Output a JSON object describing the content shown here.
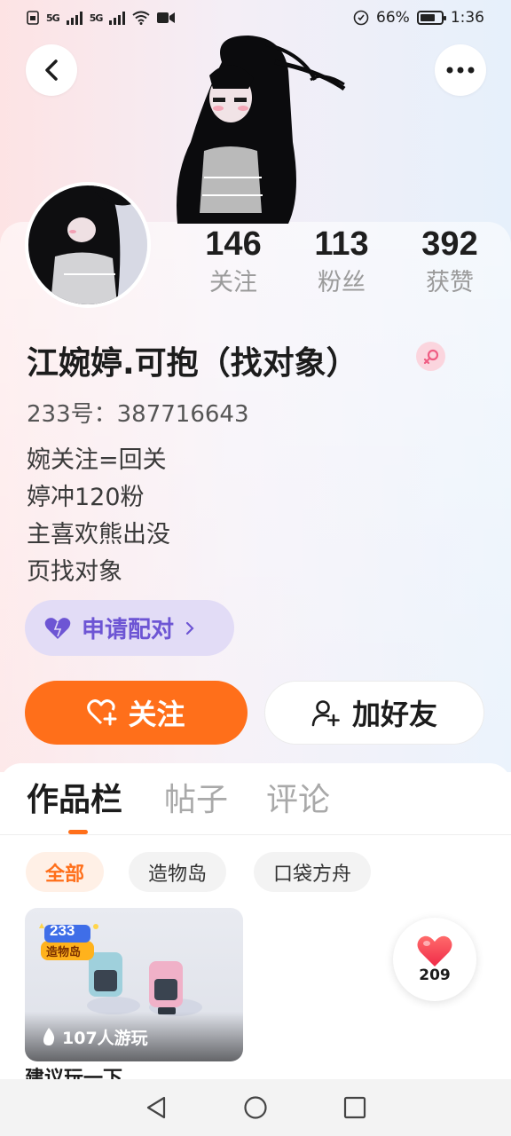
{
  "status_bar": {
    "sim1": "5G",
    "sim2": "5G",
    "battery_percent": "66%",
    "time": "1:36"
  },
  "header": {
    "back_icon": "chevron-left-icon",
    "more_icon": "more-dots-icon"
  },
  "profile": {
    "stats": [
      {
        "value": "146",
        "label": "关注"
      },
      {
        "value": "113",
        "label": "粉丝"
      },
      {
        "value": "392",
        "label": "获赞"
      }
    ],
    "name": "江婉婷.可抱（找对象）",
    "gender_icon": "female-icon",
    "uid": "233号：387716643",
    "bio": [
      "婉关注=回关",
      "婷冲120粉",
      "主喜欢熊出没",
      "页找对象"
    ],
    "match_label": "申请配对",
    "follow_label": "关注",
    "add_friend_label": "加好友"
  },
  "tabs": [
    {
      "label": "作品栏",
      "active": true
    },
    {
      "label": "帖子",
      "active": false
    },
    {
      "label": "评论",
      "active": false
    }
  ],
  "filters": [
    {
      "label": "全部",
      "active": true
    },
    {
      "label": "造物岛",
      "active": false
    },
    {
      "label": "口袋方舟",
      "active": false
    }
  ],
  "works": [
    {
      "badge_number": "233",
      "badge_text": "造物岛",
      "plays": "107人游玩",
      "title": "建议玩一下"
    }
  ],
  "like": {
    "count": "209"
  },
  "colors": {
    "accent": "#ff6f1a",
    "match_purple": "#6d55d4",
    "match_bg": "#e2dcf6"
  }
}
